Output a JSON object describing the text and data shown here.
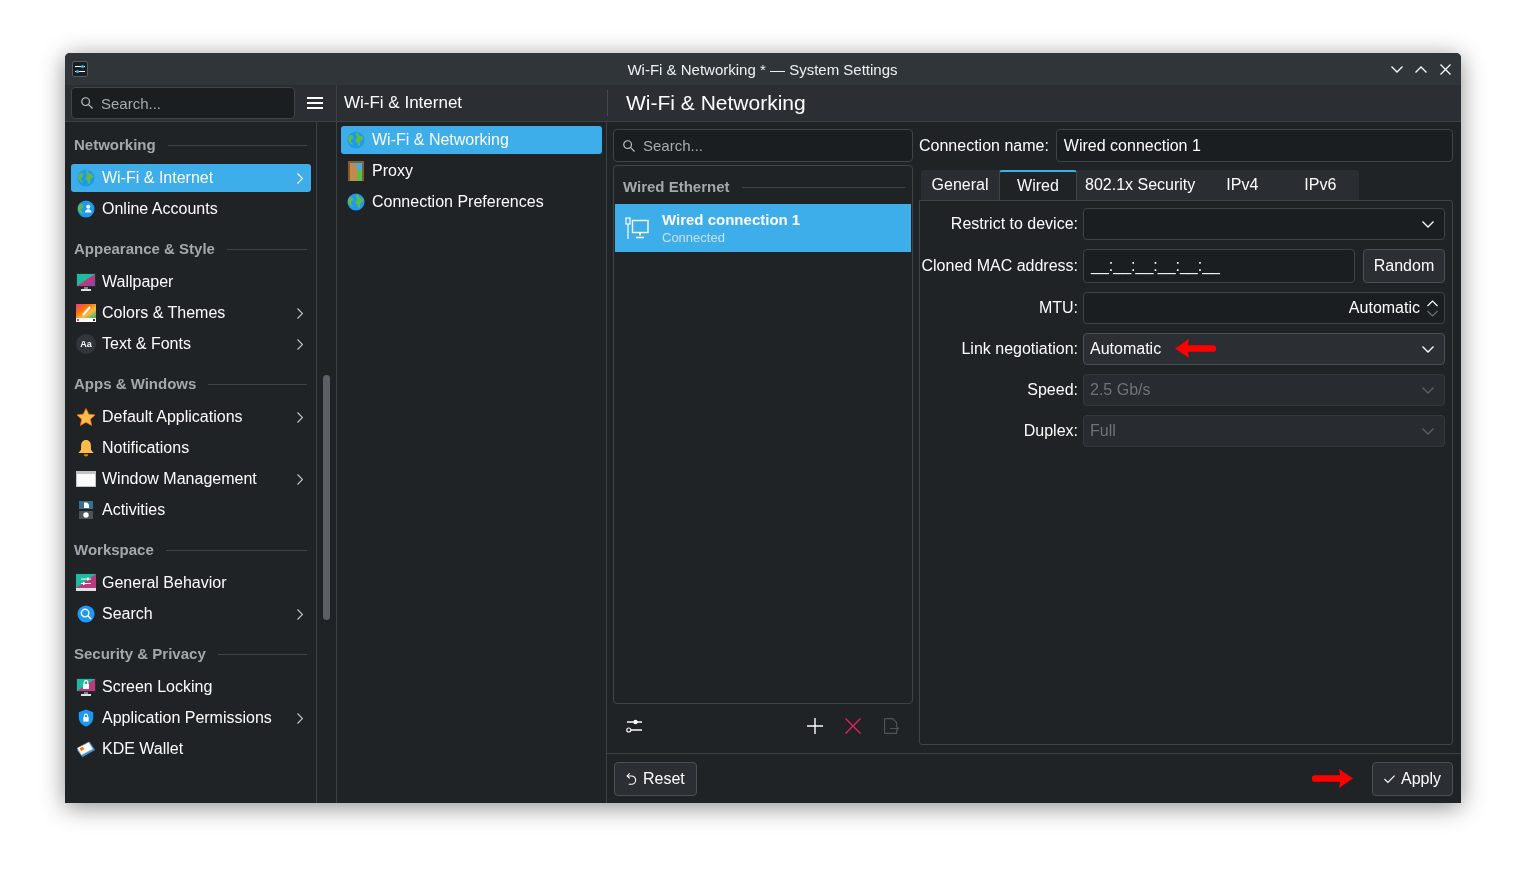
{
  "window": {
    "title": "Wi-Fi & Networking * — System Settings"
  },
  "sidebar": {
    "search": {
      "placeholder": "Search..."
    },
    "groups": [
      {
        "heading": "Networking",
        "items": [
          {
            "label": "Wi-Fi & Internet",
            "selected": true,
            "has_submenu": true
          },
          {
            "label": "Online Accounts",
            "selected": false,
            "has_submenu": false
          }
        ]
      },
      {
        "heading": "Appearance & Style",
        "items": [
          {
            "label": "Wallpaper",
            "selected": false,
            "has_submenu": false
          },
          {
            "label": "Colors & Themes",
            "selected": false,
            "has_submenu": true
          },
          {
            "label": "Text & Fonts",
            "icon_text": "Aa",
            "selected": false,
            "has_submenu": true
          }
        ]
      },
      {
        "heading": "Apps & Windows",
        "items": [
          {
            "label": "Default Applications",
            "selected": false,
            "has_submenu": true
          },
          {
            "label": "Notifications",
            "selected": false,
            "has_submenu": false
          },
          {
            "label": "Window Management",
            "selected": false,
            "has_submenu": true
          },
          {
            "label": "Activities",
            "selected": false,
            "has_submenu": false
          }
        ]
      },
      {
        "heading": "Workspace",
        "items": [
          {
            "label": "General Behavior",
            "selected": false,
            "has_submenu": false
          },
          {
            "label": "Search",
            "selected": false,
            "has_submenu": true
          }
        ]
      },
      {
        "heading": "Security & Privacy",
        "items": [
          {
            "label": "Screen Locking",
            "selected": false,
            "has_submenu": false
          },
          {
            "label": "Application Permissions",
            "selected": false,
            "has_submenu": true
          },
          {
            "label": "KDE Wallet",
            "selected": false,
            "has_submenu": false
          }
        ]
      }
    ]
  },
  "module": {
    "title": "Wi-Fi & Internet",
    "items": [
      {
        "label": "Wi-Fi & Networking",
        "selected": true
      },
      {
        "label": "Proxy",
        "selected": false
      },
      {
        "label": "Connection Preferences",
        "selected": false
      }
    ]
  },
  "page": {
    "title": "Wi-Fi & Networking"
  },
  "connections": {
    "search": {
      "placeholder": "Search..."
    },
    "groups": [
      {
        "heading": "Wired Ethernet",
        "items": [
          {
            "name": "Wired connection 1",
            "status": "Connected",
            "selected": true
          }
        ]
      }
    ],
    "toolbar": [
      {
        "kind": "configure",
        "disabled": false
      },
      {
        "kind": "add",
        "disabled": false
      },
      {
        "kind": "remove",
        "disabled": false
      },
      {
        "kind": "export",
        "disabled": true
      }
    ]
  },
  "editor": {
    "name_label": "Connection name:",
    "name_value": "Wired connection 1",
    "tabs": [
      {
        "label": "General",
        "selected": false
      },
      {
        "label": "Wired",
        "selected": true
      },
      {
        "label": "802.1x Security",
        "selected": false
      },
      {
        "label": "IPv4",
        "selected": false
      },
      {
        "label": "IPv6",
        "selected": false
      }
    ],
    "fields": [
      {
        "kind": "edit_combo",
        "label": "Restrict to device:",
        "disabled": false,
        "annotated": false
      },
      {
        "kind": "text",
        "label": "Cloned MAC address:",
        "value": "__:__:__:__:__:__",
        "button": "Random",
        "disabled": false,
        "annotated": false
      },
      {
        "kind": "spin",
        "label": "MTU:",
        "value": "Automatic",
        "disabled": false,
        "annotated": false
      },
      {
        "kind": "combo",
        "label": "Link negotiation:",
        "value": "Automatic",
        "disabled": false,
        "annotated": true
      },
      {
        "kind": "combo",
        "label": "Speed:",
        "value": "2.5 Gb/s",
        "disabled": true,
        "annotated": false
      },
      {
        "kind": "combo",
        "label": "Duplex:",
        "value": "Full",
        "disabled": true,
        "annotated": false
      }
    ]
  },
  "footer": {
    "buttons": [
      {
        "kind": "reset",
        "label": "Reset",
        "annotated": false
      },
      {
        "kind": "apply",
        "label": "Apply",
        "annotated": true
      }
    ]
  }
}
